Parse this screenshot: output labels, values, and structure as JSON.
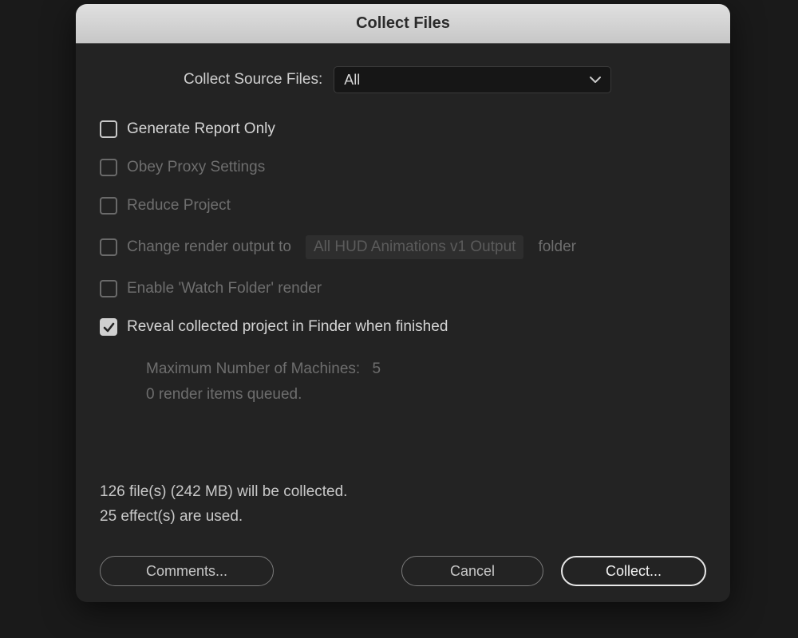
{
  "dialog": {
    "title": "Collect Files",
    "source_label": "Collect Source Files:",
    "source_value": "All",
    "checkboxes": {
      "generate_report": "Generate Report Only",
      "obey_proxy": "Obey Proxy Settings",
      "reduce_project": "Reduce Project",
      "change_output_prefix": "Change render output to",
      "change_output_value": "All HUD Animations v1 Output",
      "change_output_suffix": "folder",
      "enable_watch": "Enable 'Watch Folder' render",
      "reveal_finder": "Reveal collected project in Finder when finished"
    },
    "machines_label": "Maximum Number of Machines:",
    "machines_value": "5",
    "queued_text": "0 render items queued.",
    "summary_line1": "126 file(s) (242 MB) will be collected.",
    "summary_line2": "25 effect(s) are used.",
    "buttons": {
      "comments": "Comments...",
      "cancel": "Cancel",
      "collect": "Collect..."
    }
  }
}
